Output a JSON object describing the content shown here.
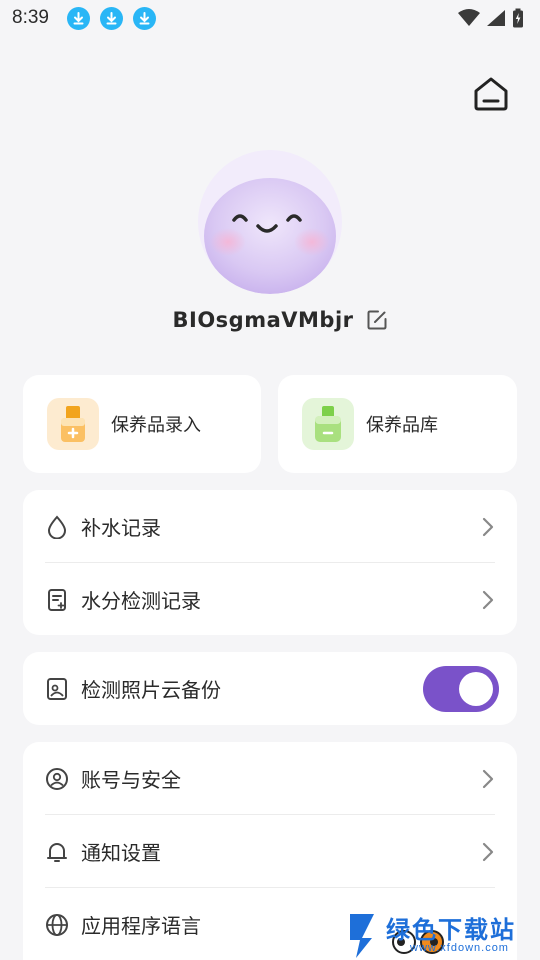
{
  "status_bar": {
    "time": "8:39"
  },
  "profile": {
    "username": "BIOsgmaVMbjr"
  },
  "quick_actions": [
    {
      "label": "保养品录入",
      "icon": "skincare-entry-icon"
    },
    {
      "label": "保养品库",
      "icon": "skincare-library-icon"
    }
  ],
  "records": [
    {
      "label": "补水记录",
      "icon": "water-drop-icon"
    },
    {
      "label": "水分检测记录",
      "icon": "detection-record-icon"
    }
  ],
  "backup": {
    "label": "检测照片云备份",
    "enabled": true,
    "icon": "photo-backup-icon"
  },
  "settings": [
    {
      "label": "账号与安全",
      "icon": "account-icon"
    },
    {
      "label": "通知设置",
      "icon": "bell-icon"
    },
    {
      "label": "应用程序语言",
      "icon": "globe-icon"
    }
  ],
  "watermark": {
    "text": "绿色下载站",
    "url": "www.xfdown.com"
  },
  "colors": {
    "accent": "#7a52c9",
    "background": "#f5f5f7",
    "card": "#ffffff",
    "download_badge": "#29b6f6"
  }
}
